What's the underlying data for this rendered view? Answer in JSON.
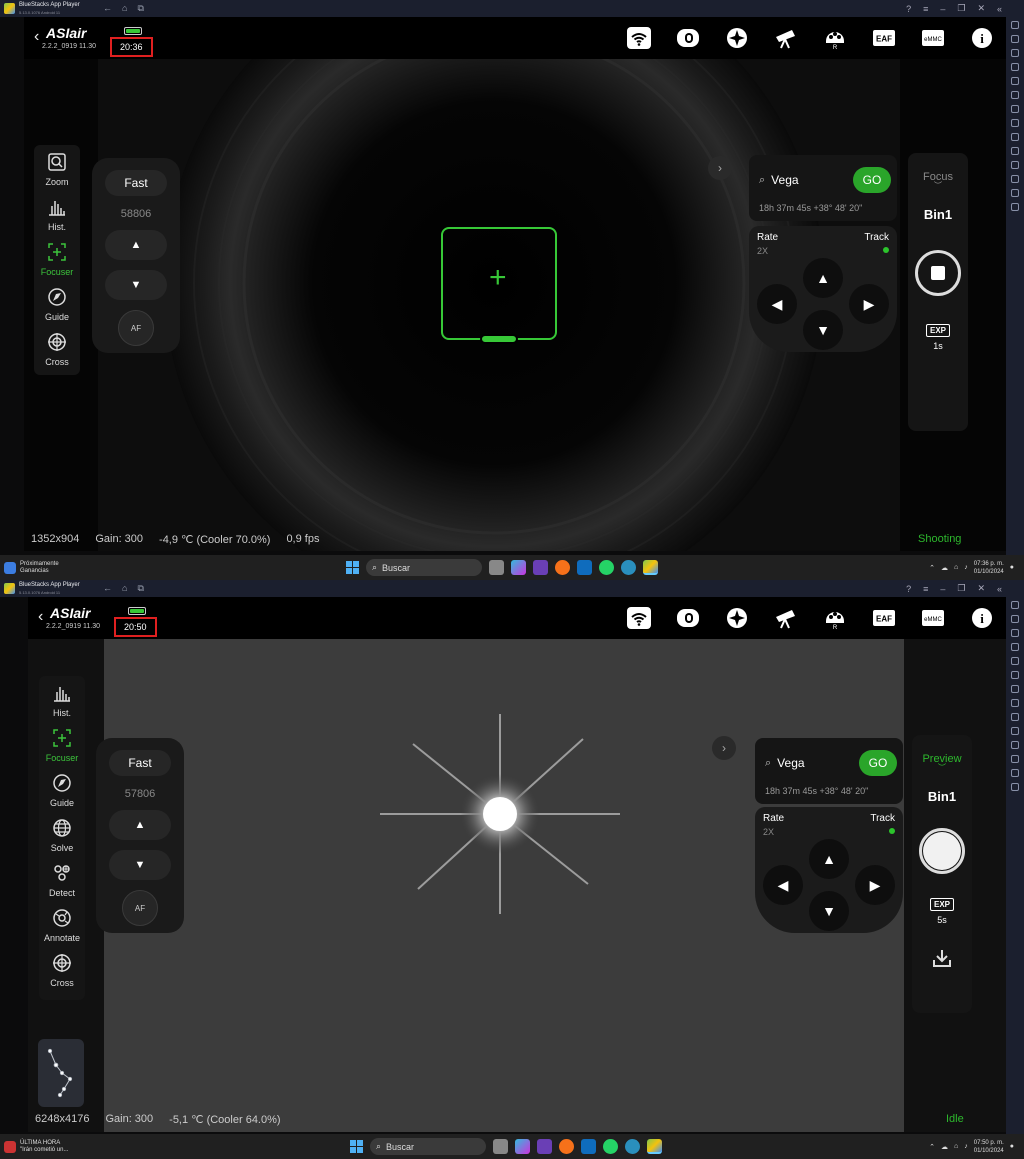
{
  "window": {
    "app_name": "BlueStacks App Player",
    "app_version": "5.13.0.1076 Android 11"
  },
  "top": {
    "version": "2.2.2_0919 11.30",
    "clock": "20:36",
    "mode": "Focus",
    "bin": "Bin1",
    "exp_label": "EXP",
    "exp_value": "1s",
    "status": {
      "resolution": "1352x904",
      "gain": "Gain: 300",
      "temp": "-4,9 ℃ (Cooler 70.0%)",
      "fps": "0,9 fps"
    },
    "state": "Shooting",
    "focuser": {
      "speed": "Fast",
      "position": "58806",
      "af": "AF"
    },
    "left_menu": [
      {
        "label": "Zoom",
        "icon": "zoom-icon"
      },
      {
        "label": "Hist.",
        "icon": "histogram-icon"
      },
      {
        "label": "Focuser",
        "icon": "focuser-icon"
      },
      {
        "label": "Guide",
        "icon": "guide-icon"
      },
      {
        "label": "Cross",
        "icon": "crosshair-icon"
      }
    ],
    "news": [
      "Próximamente",
      "Ganancias"
    ],
    "taskbar_time": [
      "07:36 p. m.",
      "01/10/2024"
    ]
  },
  "bottom": {
    "version": "2.2.2_0919 11.30",
    "clock": "20:50",
    "mode": "Preview",
    "bin": "Bin1",
    "exp_label": "EXP",
    "exp_value": "5s",
    "status": {
      "resolution": "6248x4176",
      "gain": "Gain: 300",
      "temp": "-5,1 ℃ (Cooler 64.0%)"
    },
    "state": "Idle",
    "focuser": {
      "speed": "Fast",
      "position": "57806",
      "af": "AF"
    },
    "left_menu": [
      {
        "label": "Hist.",
        "icon": "histogram-icon"
      },
      {
        "label": "Focuser",
        "icon": "focuser-icon"
      },
      {
        "label": "Guide",
        "icon": "guide-icon"
      },
      {
        "label": "Solve",
        "icon": "globe-icon"
      },
      {
        "label": "Detect",
        "icon": "detect-icon"
      },
      {
        "label": "Annotate",
        "icon": "annotate-icon"
      },
      {
        "label": "Cross",
        "icon": "crosshair-icon"
      }
    ],
    "news": [
      "ÚLTIMA HORA",
      "\"Irán cometió un..."
    ],
    "taskbar_time": [
      "07:50 p. m.",
      "01/10/2024"
    ]
  },
  "goto": {
    "target": "Vega",
    "go": "GO",
    "coords": "18h 37m 45s   +38° 48' 20\""
  },
  "mount": {
    "rate_label": "Rate",
    "rate_value": "2X",
    "track_label": "Track"
  },
  "topbar_icons": [
    "wifi-icon",
    "camera-icon",
    "mount-icon",
    "telescope-icon",
    "filter-wheel-icon",
    "eaf-icon",
    "emmc-icon",
    "info-icon"
  ],
  "topbar_icon_text": {
    "filter": "R",
    "eaf": "EAF",
    "emmc": "eMMC",
    "info": "i"
  },
  "taskbar": {
    "search": "Buscar"
  },
  "colors": {
    "accent": "#2aa52a",
    "highlight": "#e02020"
  }
}
